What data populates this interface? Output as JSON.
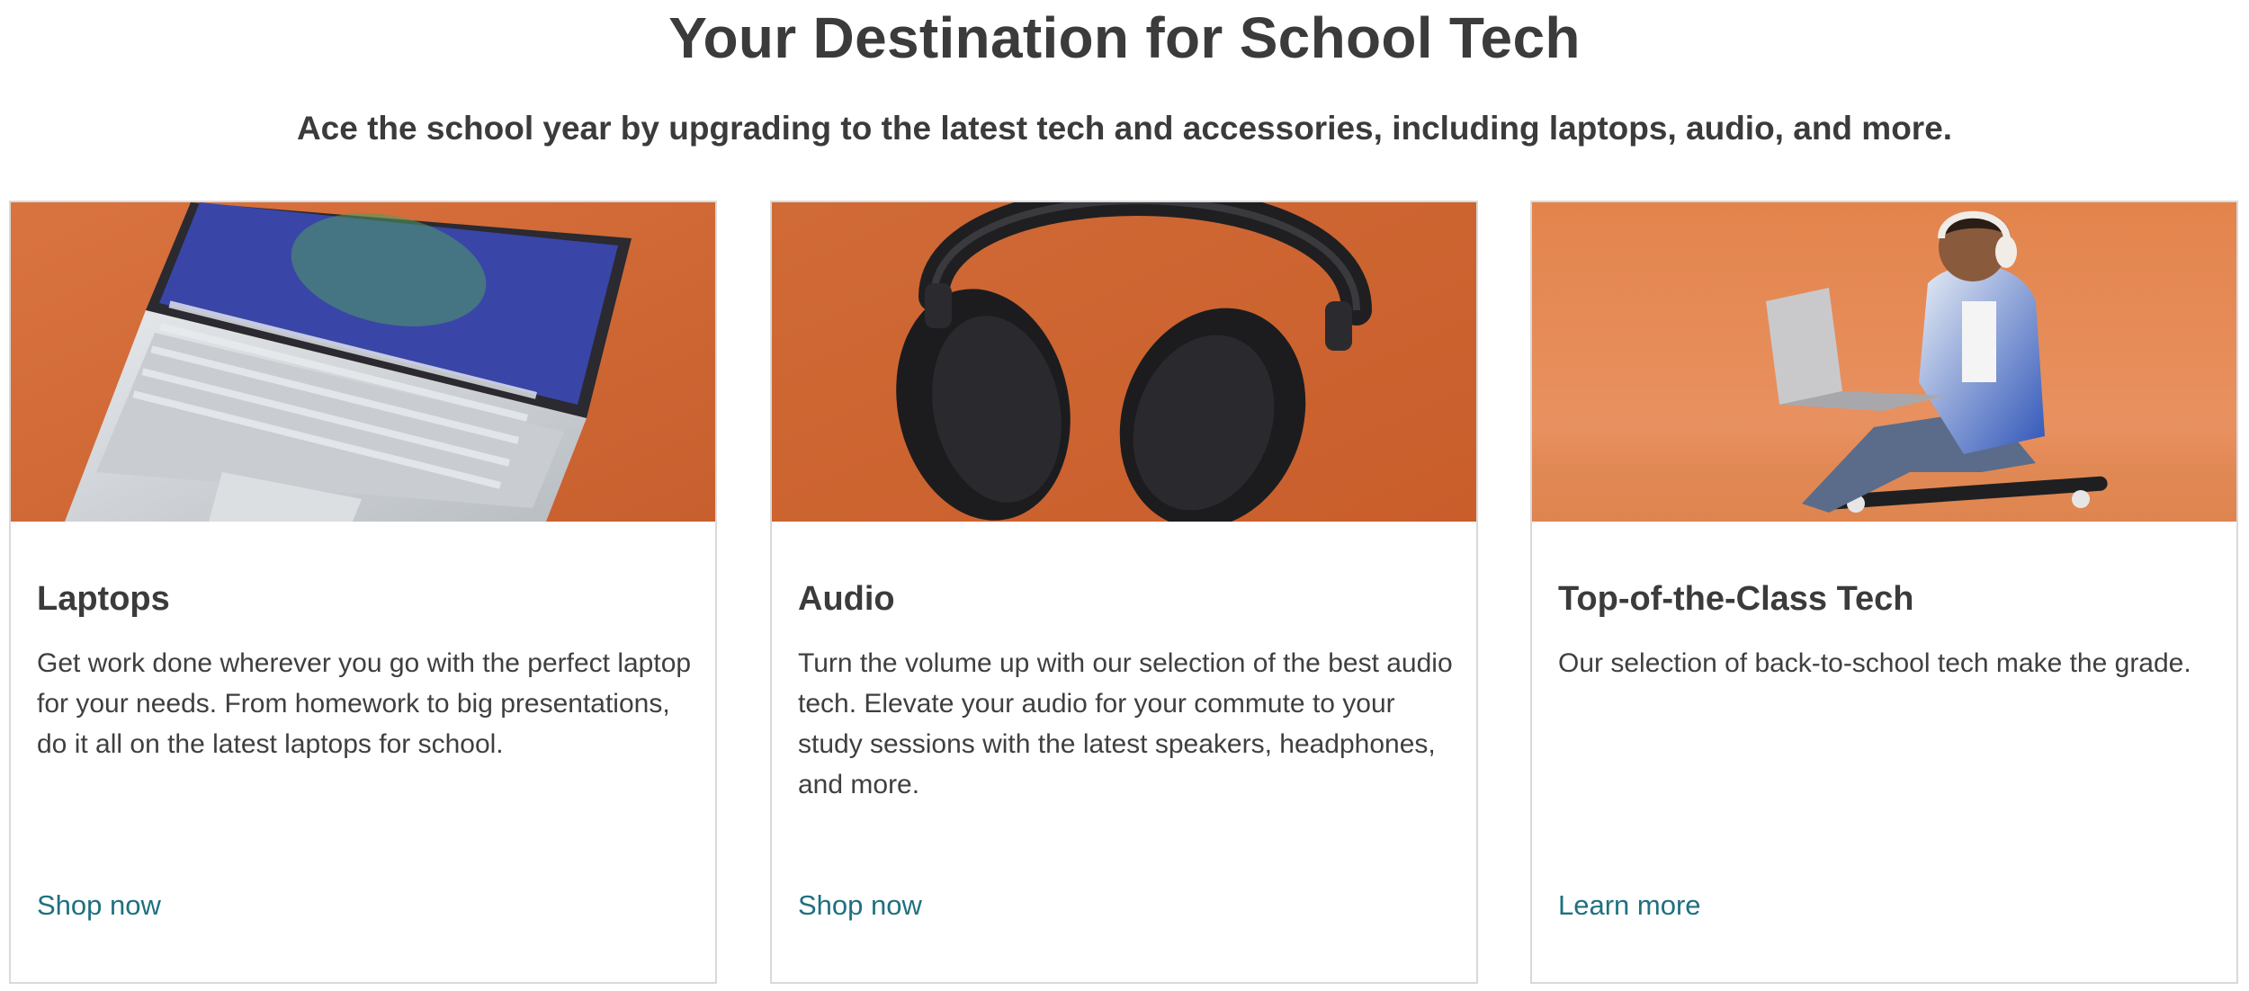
{
  "header": {
    "title": "Your Destination for School Tech",
    "subtitle": "Ace the school year by upgrading to the latest tech and accessories, including laptops, audio, and more."
  },
  "cards": [
    {
      "image_icon": "laptop-photo",
      "title": "Laptops",
      "description": "Get work done wherever you go with the perfect laptop for your needs. From homework to big presentations, do it all on the latest laptops for school.",
      "link": "Shop now"
    },
    {
      "image_icon": "headphones-photo",
      "title": "Audio",
      "description": "Turn the volume up with our selection of the best audio tech. Elevate your audio for your commute to your study sessions with the latest speakers, headphones, and more.",
      "link": "Shop now"
    },
    {
      "image_icon": "student-with-laptop-photo",
      "title": "Top-of-the-Class Tech",
      "description": "Our selection of back-to-school tech make the grade.",
      "link": "Learn more"
    }
  ],
  "colors": {
    "link": "#1f7080",
    "image_background": "#d2693a",
    "text": "#3b3b3b",
    "card_border": "#d9d9d9"
  }
}
